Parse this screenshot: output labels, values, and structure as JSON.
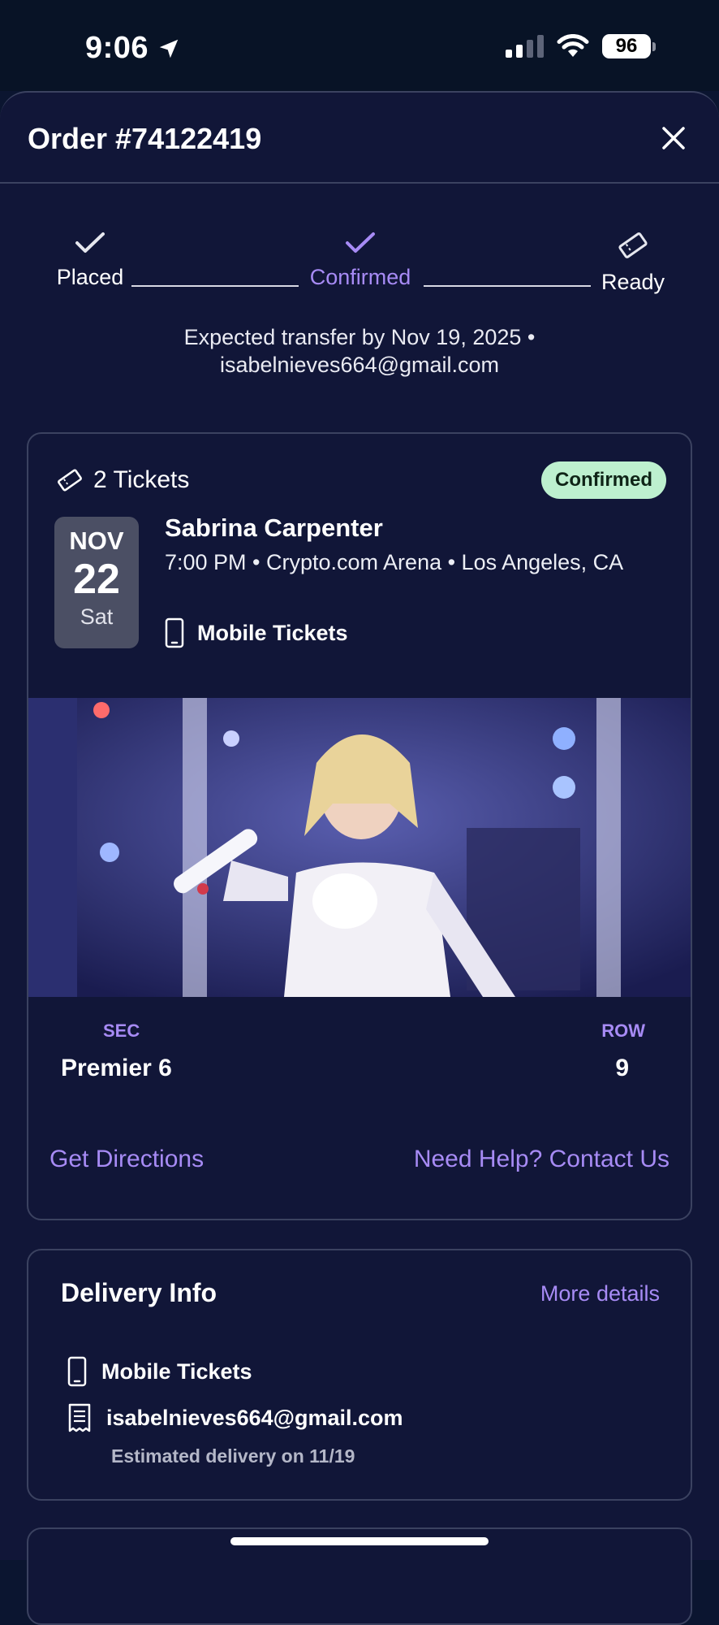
{
  "status_bar": {
    "time": "9:06",
    "battery": "96"
  },
  "header": {
    "title": "Order #74122419"
  },
  "progress": {
    "steps": [
      {
        "label": "Placed",
        "state": "done"
      },
      {
        "label": "Confirmed",
        "state": "current"
      },
      {
        "label": "Ready",
        "state": "pending"
      }
    ]
  },
  "expected": {
    "line1": "Expected transfer by Nov 19, 2025 •",
    "line2": "isabelnieves664@gmail.com"
  },
  "ticket": {
    "count_label": "2 Tickets",
    "badge": "Confirmed",
    "date": {
      "month": "NOV",
      "day": "22",
      "dow": "Sat"
    },
    "event_name": "Sabrina Carpenter",
    "event_meta": "7:00 PM • Crypto.com Arena • Los Angeles, CA",
    "ticket_type": "Mobile Tickets",
    "sec_label": "SEC",
    "sec_value": "Premier 6",
    "row_label": "ROW",
    "row_value": "9",
    "directions_label": "Get Directions",
    "help_label": "Need Help? Contact Us"
  },
  "delivery": {
    "title": "Delivery Info",
    "more_label": "More details",
    "method": "Mobile Tickets",
    "email": "isabelnieves664@gmail.com",
    "estimate": "Estimated delivery on 11/19"
  },
  "colors": {
    "accent": "#a78bf5",
    "background": "#111638",
    "badge_bg": "#bdf0cf",
    "border": "#3b4260"
  }
}
